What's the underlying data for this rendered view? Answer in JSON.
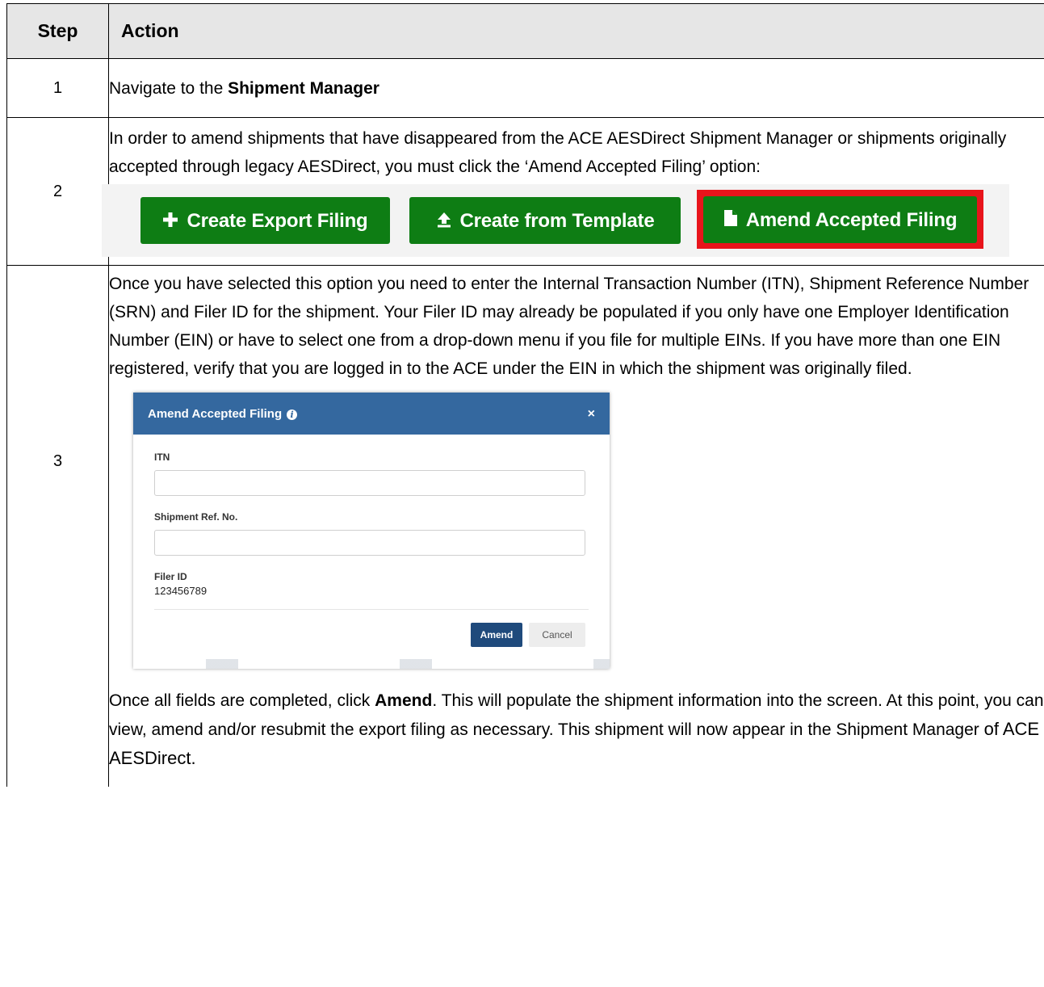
{
  "table": {
    "header": {
      "step": "Step",
      "action": "Action"
    },
    "rows": [
      {
        "step": "1",
        "text_before": "Navigate to the ",
        "text_bold": "Shipment Manager"
      },
      {
        "step": "2",
        "text": "In order to amend shipments that have disappeared from the ACE AESDirect Shipment Manager or shipments originally accepted through legacy AESDirect, you must click the ‘Amend Accepted Filing’ option:",
        "buttons": [
          {
            "label": "Create Export Filing",
            "icon": "plus-icon"
          },
          {
            "label": "Create from Template",
            "icon": "upload-icon"
          },
          {
            "label": "Amend Accepted Filing",
            "icon": "document-icon"
          }
        ],
        "highlight_color": "#e8141b",
        "button_color": "#0e7d14"
      },
      {
        "step": "3",
        "text": "Once you have selected this option you need to enter the Internal Transaction Number (ITN), Shipment Reference Number (SRN) and Filer ID for the shipment. Your Filer ID may already be populated if you only have one Employer Identification Number (EIN) or have to select one from a drop-down menu if you file for multiple EINs. If you have more than one EIN registered, verify that you are logged in to the ACE under the EIN in which the shipment was originally filed.",
        "modal": {
          "title": "Amend Accepted Filing",
          "itn_label": "ITN",
          "itn_value": "",
          "srn_label": "Shipment Ref. No.",
          "srn_value": "",
          "filer_label": "Filer ID",
          "filer_value": "123456789",
          "amend_label": "Amend",
          "cancel_label": "Cancel",
          "close_glyph": "×",
          "header_color": "#34689f"
        },
        "after_before": "Once all fields are completed, click ",
        "after_bold": "Amend",
        "after_mid": ". This will populate the shipment information into the screen. At this point, you can view, amend and/or resubmit the export filing as necessary. This shipment will now appear in the Shipment Manager ",
        "after_last": "of ACE AESDirect."
      }
    ]
  }
}
